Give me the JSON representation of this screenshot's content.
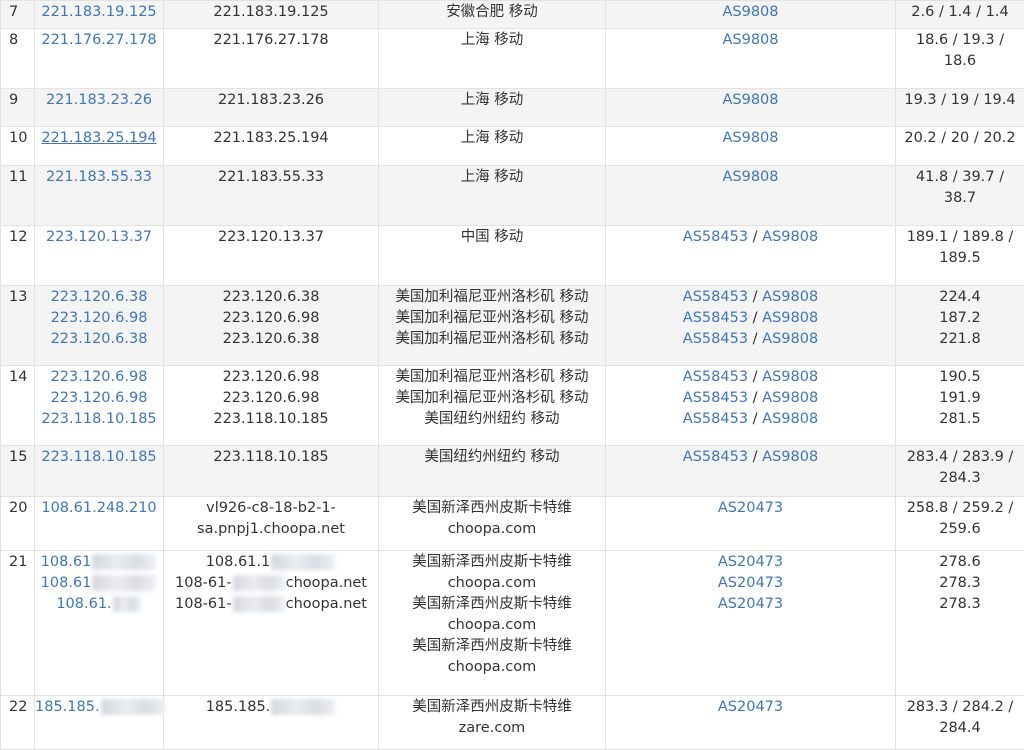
{
  "rows": [
    {
      "hop": "7",
      "shade": true,
      "h": 28,
      "ips": [
        {
          "text": "221.183.19.125"
        }
      ],
      "hosts": [
        {
          "text": "221.183.19.125"
        }
      ],
      "geo": [
        "安徽合肥 移动"
      ],
      "asn": [
        [
          "AS9808"
        ]
      ],
      "time": [
        "2.6 / 1.4 / 1.4"
      ]
    },
    {
      "hop": "8",
      "shade": false,
      "h": 60,
      "ips": [
        {
          "text": "221.176.27.178"
        }
      ],
      "hosts": [
        {
          "text": "221.176.27.178"
        }
      ],
      "geo": [
        "上海 移动"
      ],
      "asn": [
        [
          "AS9808"
        ]
      ],
      "time": [
        "18.6 / 19.3 /",
        "18.6"
      ]
    },
    {
      "hop": "9",
      "shade": true,
      "h": 38,
      "ips": [
        {
          "text": "221.183.23.26"
        }
      ],
      "hosts": [
        {
          "text": "221.183.23.26"
        }
      ],
      "geo": [
        "上海 移动"
      ],
      "asn": [
        [
          "AS9808"
        ]
      ],
      "time": [
        "19.3 / 19 / 19.4"
      ]
    },
    {
      "hop": "10",
      "shade": false,
      "h": 39,
      "ips": [
        {
          "text": "221.183.25.194",
          "underline": true
        }
      ],
      "hosts": [
        {
          "text": "221.183.25.194"
        }
      ],
      "geo": [
        "上海 移动"
      ],
      "asn": [
        [
          "AS9808"
        ]
      ],
      "time": [
        "20.2 / 20 / 20.2"
      ]
    },
    {
      "hop": "11",
      "shade": true,
      "h": 60,
      "ips": [
        {
          "text": "221.183.55.33"
        }
      ],
      "hosts": [
        {
          "text": "221.183.55.33"
        }
      ],
      "geo": [
        "上海 移动"
      ],
      "asn": [
        [
          "AS9808"
        ]
      ],
      "time": [
        "41.8 / 39.7 /",
        "38.7"
      ]
    },
    {
      "hop": "12",
      "shade": false,
      "h": 60,
      "ips": [
        {
          "text": "223.120.13.37"
        }
      ],
      "hosts": [
        {
          "text": "223.120.13.37"
        }
      ],
      "geo": [
        "中国 移动"
      ],
      "asn": [
        [
          "AS58453",
          "AS9808"
        ]
      ],
      "time": [
        "189.1 / 189.8 /",
        "189.5"
      ]
    },
    {
      "hop": "13",
      "shade": true,
      "h": 80,
      "ips": [
        {
          "text": "223.120.6.38"
        },
        {
          "text": "223.120.6.98"
        },
        {
          "text": "223.120.6.38"
        }
      ],
      "hosts": [
        {
          "text": "223.120.6.38"
        },
        {
          "text": "223.120.6.98"
        },
        {
          "text": "223.120.6.38"
        }
      ],
      "geo": [
        "美国加利福尼亚州洛杉矶 移动",
        "美国加利福尼亚州洛杉矶 移动",
        "美国加利福尼亚州洛杉矶 移动"
      ],
      "asn": [
        [
          "AS58453",
          "AS9808"
        ],
        [
          "AS58453",
          "AS9808"
        ],
        [
          "AS58453",
          "AS9808"
        ]
      ],
      "time": [
        "224.4",
        "187.2",
        "221.8"
      ]
    },
    {
      "hop": "14",
      "shade": false,
      "h": 80,
      "ips": [
        {
          "text": "223.120.6.98"
        },
        {
          "text": "223.120.6.98"
        },
        {
          "text": "223.118.10.185"
        }
      ],
      "hosts": [
        {
          "text": "223.120.6.98"
        },
        {
          "text": "223.120.6.98"
        },
        {
          "text": "223.118.10.185"
        }
      ],
      "geo": [
        "美国加利福尼亚州洛杉矶 移动",
        "美国加利福尼亚州洛杉矶 移动",
        "美国纽约州纽约 移动"
      ],
      "asn": [
        [
          "AS58453",
          "AS9808"
        ],
        [
          "AS58453",
          "AS9808"
        ],
        [
          "AS58453",
          "AS9808"
        ]
      ],
      "time": [
        "190.5",
        "191.9",
        "281.5"
      ]
    },
    {
      "hop": "15",
      "shade": true,
      "h": 51,
      "ips": [
        {
          "text": "223.118.10.185"
        }
      ],
      "hosts": [
        {
          "text": "223.118.10.185"
        }
      ],
      "geo": [
        "美国纽约州纽约 移动"
      ],
      "asn": [
        [
          "AS58453",
          "AS9808"
        ]
      ],
      "time": [
        "283.4 / 283.9 /",
        "284.3"
      ]
    },
    {
      "hop": "20",
      "shade": false,
      "h": 54,
      "ips": [
        {
          "text": "108.61.248.210"
        }
      ],
      "hosts": [
        {
          "text": "vl926-c8-18-b2-1-"
        },
        {
          "text": "sa.pnpj1.choopa.net"
        }
      ],
      "geo": [
        "美国新泽西州皮斯卡特维",
        "choopa.com"
      ],
      "asn": [
        [
          "AS20473"
        ]
      ],
      "time": [
        "258.8 / 259.2 /",
        "259.6"
      ]
    },
    {
      "hop": "21",
      "shade": false,
      "h": 145,
      "ips": [
        {
          "text": "108.61",
          "blur": "wide"
        },
        {
          "text": "108.61",
          "blur": "wide"
        },
        {
          "text": "108.61.",
          "blur": "short"
        }
      ],
      "hosts": [
        {
          "text": "108.61.1",
          "blur": "wide",
          "post": ""
        },
        {
          "text": "108-61-",
          "blur": "",
          "post": "choopa.net"
        },
        {
          "text": "108-61-",
          "blur": "",
          "post": "choopa.net"
        }
      ],
      "geo": [
        "美国新泽西州皮斯卡特维",
        "choopa.com",
        "美国新泽西州皮斯卡特维",
        "choopa.com",
        "美国新泽西州皮斯卡特维",
        "choopa.com"
      ],
      "asn": [
        [
          "AS20473"
        ],
        [
          "AS20473"
        ],
        [
          "AS20473"
        ]
      ],
      "time": [
        "278.6",
        "278.3",
        "278.3"
      ]
    },
    {
      "hop": "22",
      "shade": false,
      "h": 54,
      "ips": [
        {
          "text": "185.185.",
          "blur": "wide"
        }
      ],
      "hosts": [
        {
          "text": "185.185.",
          "blur": "wide",
          "post": ""
        }
      ],
      "geo": [
        "美国新泽西州皮斯卡特维",
        "zare.com"
      ],
      "asn": [
        [
          "AS20473"
        ]
      ],
      "time": [
        "283.3 / 284.2 /",
        "284.4"
      ]
    }
  ]
}
